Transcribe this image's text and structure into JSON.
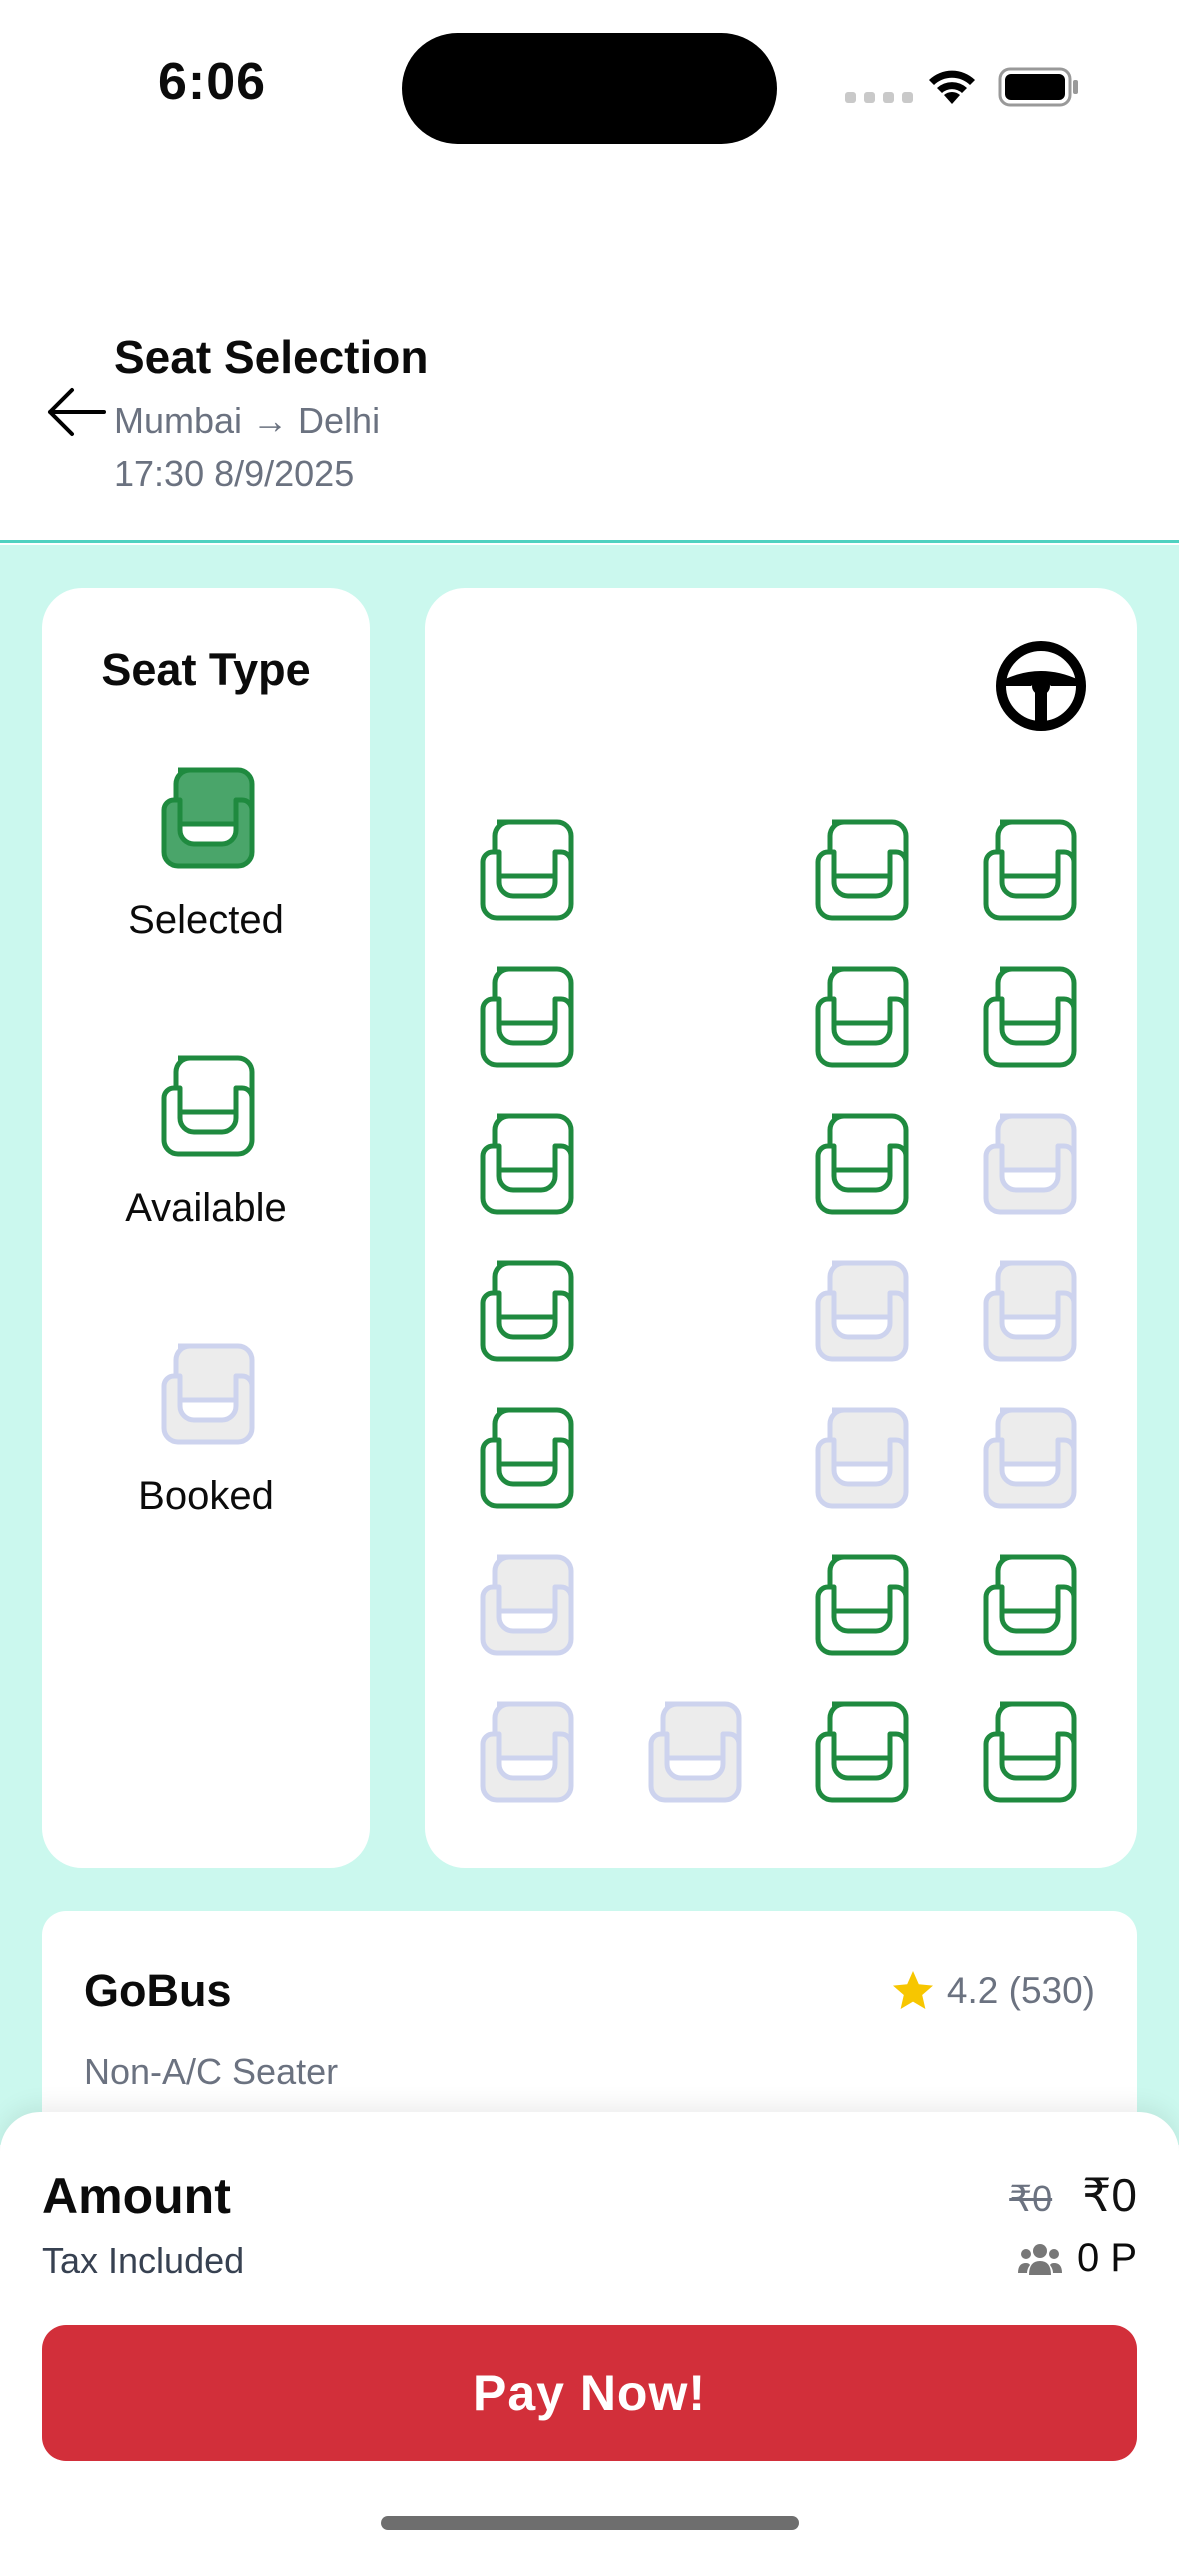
{
  "status_bar": {
    "time": "6:06"
  },
  "header": {
    "title": "Seat Selection",
    "route": "Mumbai → Delhi",
    "datetime": "17:30 8/9/2025"
  },
  "legend": {
    "title": "Seat Type",
    "items": [
      {
        "label": "Selected",
        "state": "selected"
      },
      {
        "label": "Available",
        "state": "available"
      },
      {
        "label": "Booked",
        "state": "booked"
      }
    ]
  },
  "seat_map": {
    "icon": "steering-wheel-icon",
    "rows": [
      [
        "available",
        null,
        "available",
        "available"
      ],
      [
        "available",
        null,
        "available",
        "available"
      ],
      [
        "available",
        null,
        "available",
        "booked"
      ],
      [
        "available",
        null,
        "booked",
        "booked"
      ],
      [
        "available",
        null,
        "booked",
        "booked"
      ],
      [
        "booked",
        null,
        "available",
        "available"
      ],
      [
        "booked",
        "booked",
        "available",
        "available"
      ]
    ]
  },
  "operator": {
    "name": "GoBus",
    "type": "Non-A/C Seater",
    "rating": "4.2 (530)"
  },
  "summary": {
    "amount_label": "Amount",
    "tax_label": "Tax Included",
    "old_price": "₹0",
    "price": "₹0",
    "passengers": "0 P",
    "pay_label": "Pay Now!"
  },
  "colors": {
    "accent_green": "#1f8a3f",
    "selected_fill": "#4aa56a",
    "booked_fill": "#ececec",
    "booked_stroke": "#cdd3ee",
    "mint_bg": "#cbf8ee",
    "pay_red": "#d22f3a"
  }
}
